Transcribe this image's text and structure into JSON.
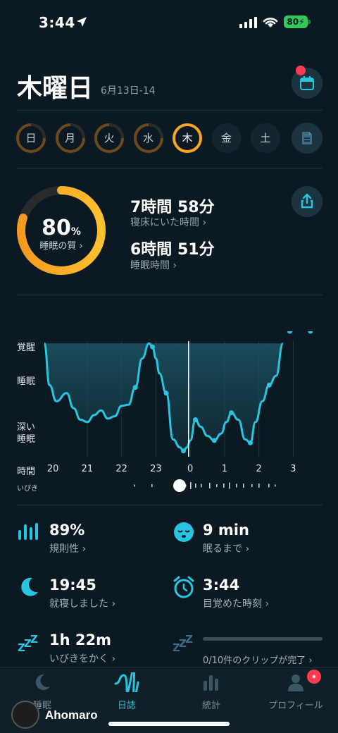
{
  "status_bar": {
    "time": "3:44",
    "battery": "80"
  },
  "header": {
    "title": "木曜日",
    "date_range": "6月13日-14"
  },
  "week": [
    {
      "label": "日",
      "selected": false,
      "has_data": true
    },
    {
      "label": "月",
      "selected": false,
      "has_data": true
    },
    {
      "label": "火",
      "selected": false,
      "has_data": true
    },
    {
      "label": "水",
      "selected": false,
      "has_data": true
    },
    {
      "label": "木",
      "selected": true,
      "has_data": true
    },
    {
      "label": "金",
      "selected": false,
      "has_data": false
    },
    {
      "label": "土",
      "selected": false,
      "has_data": false
    }
  ],
  "summary": {
    "quality_value": "80",
    "quality_unit": "%",
    "quality_label": "睡眠の質 ›",
    "quality_percent": 80,
    "time_in_bed": "7時間 58分",
    "time_in_bed_label": "寝床にいた時間 ›",
    "sleep_time": "6時間 51分",
    "sleep_time_label": "睡眠時間 ›"
  },
  "chart_data": {
    "type": "area",
    "y_categories": [
      "覚醒",
      "睡眠",
      "深い睡眠"
    ],
    "x_axis_title": "時間",
    "x_ticks": [
      "20",
      "21",
      "22",
      "23",
      "0",
      "1",
      "2",
      "3"
    ],
    "x": [
      19.75,
      19.9,
      20.1,
      20.4,
      20.6,
      20.8,
      21.0,
      21.2,
      21.4,
      21.6,
      21.8,
      22.0,
      22.2,
      22.4,
      22.6,
      22.8,
      22.9,
      23.0,
      23.1,
      23.3,
      23.5,
      23.7,
      23.8,
      23.9,
      24.0,
      24.15,
      24.3,
      24.5,
      24.7,
      24.9,
      25.05,
      25.2,
      25.4,
      25.6,
      25.75,
      25.9,
      26.1,
      26.3,
      26.5,
      26.7,
      26.9,
      27.1,
      27.3,
      27.5,
      27.7
    ],
    "y": [
      0.98,
      0.62,
      0.48,
      0.55,
      0.42,
      0.32,
      0.3,
      0.36,
      0.4,
      0.33,
      0.35,
      0.44,
      0.45,
      0.6,
      0.85,
      0.98,
      0.95,
      0.85,
      0.72,
      0.55,
      0.15,
      0.08,
      0.05,
      0.08,
      0.14,
      0.32,
      0.26,
      0.18,
      0.14,
      0.2,
      0.3,
      0.38,
      0.32,
      0.15,
      0.12,
      0.3,
      0.48,
      0.62,
      0.7,
      0.98
    ]
  },
  "snore": {
    "label": "いびき"
  },
  "metrics": {
    "regularity_value": "89%",
    "regularity_label": "規則性 ›",
    "fall_asleep_value": "9 min",
    "fall_asleep_label": "眠るまで ›",
    "bedtime_value": "19:45",
    "bedtime_label": "就寝しました ›",
    "wake_value": "3:44",
    "wake_label": "目覚めた時刻 ›",
    "snoring_value": "1h 22m",
    "snoring_label": "いびきをかく ›",
    "clips_label": "0/10件のクリップが完了 ›",
    "clips_progress": 0
  },
  "nav": [
    {
      "label": "睡眠",
      "icon": "moon-icon",
      "active": false
    },
    {
      "label": "日誌",
      "icon": "waveform-icon",
      "active": true
    },
    {
      "label": "統計",
      "icon": "bar-chart-icon",
      "active": false
    },
    {
      "label": "プロフィール",
      "icon": "person-icon",
      "active": false
    }
  ],
  "watermark": "Ahomaro",
  "colors": {
    "background": "#0b1a22",
    "accent": "#29c4e0",
    "orange": "#f5a623",
    "brown": "#6b4a1e"
  }
}
